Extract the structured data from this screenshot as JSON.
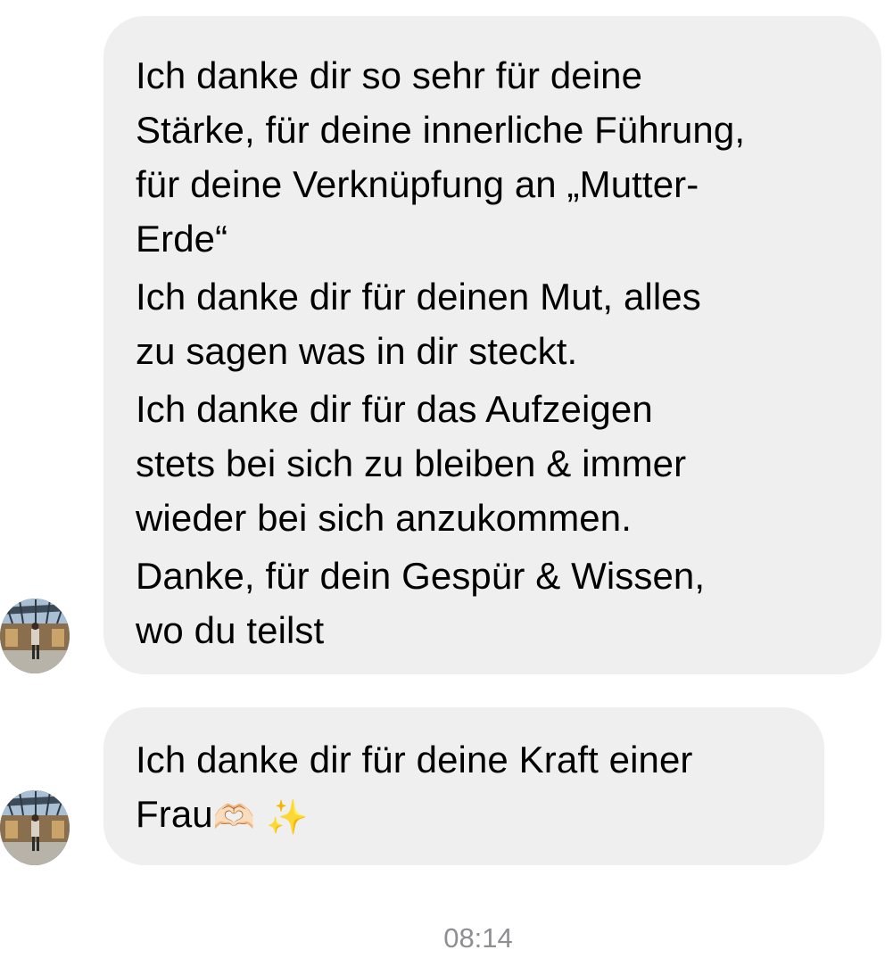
{
  "messages": [
    {
      "paragraphs": [
        [
          "Ich danke dir so sehr für deine",
          "Stärke, für deine innerliche Führung,",
          "für deine Verknüpfung an „Mutter-",
          "Erde“"
        ],
        [
          "Ich danke dir für deinen Mut, alles",
          "zu sagen was in dir steckt."
        ],
        [
          "Ich danke dir für das Aufzeigen",
          "stets bei sich zu bleiben & immer",
          "wieder bei sich anzukommen."
        ],
        [
          "Danke, für dein Gespür & Wissen,",
          "wo du teilst"
        ]
      ]
    },
    {
      "line1": "Ich danke dir für deine Kraft einer",
      "line2": "Frau",
      "emoji_1": "🫶🏻",
      "emoji_2": "✨"
    }
  ],
  "icons": {
    "avatar": "profile-photo-icon",
    "heart_hands": "heart-hands-emoji-icon",
    "sparkles": "sparkles-emoji-icon"
  },
  "colors": {
    "bubble_background": "#efefef",
    "timestamp_text": "#8e8e93"
  },
  "timestamp": "08:14"
}
